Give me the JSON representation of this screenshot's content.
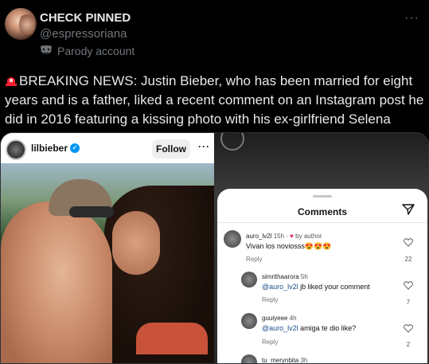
{
  "tweet": {
    "display_name": "CHECK PINNED",
    "handle": "@espressoriana",
    "parody_label": "Parody account",
    "body": "BREAKING NEWS: Justin Bieber, who has been married for eight years and is a father, liked a recent comment on an Instagram post he did in 2016 featuring a kissing photo with his ex-girlfriend Selena Gomez.",
    "more_label": "···"
  },
  "instagram_post": {
    "username": "lilbieber",
    "follow_label": "Follow",
    "more_label": "···"
  },
  "comments_sheet": {
    "title": "Comments",
    "comments": [
      {
        "user": "auro_lv2l",
        "time": "15h",
        "tag": "by author",
        "text": "Vivan los noviosss😍😍😍",
        "reply": "Reply",
        "likes": "22"
      },
      {
        "user": "simrithaarora",
        "time": "5h",
        "mention": "@auro_lv2l",
        "text": " jb liked your comment",
        "reply": "Reply",
        "likes": "7"
      },
      {
        "user": "guuiyeee",
        "time": "4h",
        "mention": "@auro_lv2l",
        "text": " amiga te dio like?",
        "reply": "Reply",
        "likes": "2"
      },
      {
        "user": "tu_merynbita",
        "time": "3h"
      }
    ]
  },
  "colors": {
    "background": "#000000",
    "text": "#e7e9ea",
    "muted": "#71767b",
    "siren": "#f4212e",
    "verified": "#0095f6"
  }
}
